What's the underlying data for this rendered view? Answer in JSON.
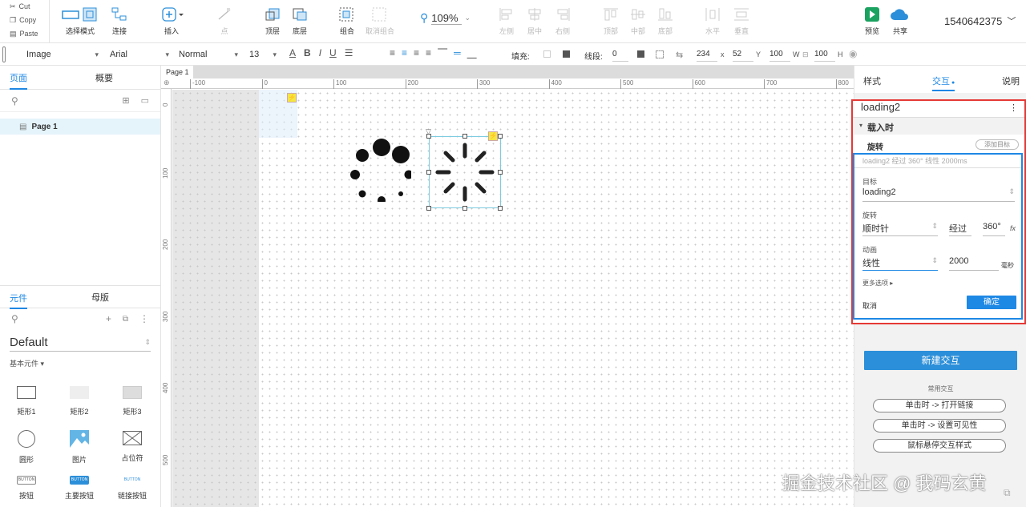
{
  "clipboard": {
    "cut": "Cut",
    "copy": "Copy",
    "paste": "Paste"
  },
  "toolbar": {
    "select_mode": "选择模式",
    "connect": "连接",
    "insert": "插入",
    "point": "点",
    "top": "顶层",
    "bottom": "底层",
    "group": "组合",
    "ungroup": "取消组合",
    "zoom": "109%",
    "left": "左侧",
    "center": "居中",
    "right": "右侧",
    "top_align": "顶部",
    "middle": "中部",
    "bottom_align": "底部",
    "horizontal": "水平",
    "vertical": "垂直",
    "preview": "预览",
    "share": "共享",
    "user": "1540642375"
  },
  "format": {
    "element_type": "Image",
    "font": "Arial",
    "style": "Normal",
    "size": "13",
    "fill_label": "填充:",
    "line_label": "线段:",
    "line_value": "0",
    "x": "234",
    "x_label": "x",
    "y": "52",
    "y_label": "Y",
    "w": "100",
    "w_label": "W",
    "h": "100",
    "h_label": "H"
  },
  "left_panel": {
    "tab_pages": "页面",
    "tab_outline": "概要",
    "page1": "Page 1",
    "tab_widgets": "元件",
    "tab_masters": "母版",
    "library": "Default",
    "section": "基本元件 ▾",
    "widgets": [
      {
        "label": "矩形1"
      },
      {
        "label": "矩形2"
      },
      {
        "label": "矩形3"
      },
      {
        "label": "圆形"
      },
      {
        "label": "图片"
      },
      {
        "label": "占位符"
      },
      {
        "label": "按钮",
        "preview": "BUTTON"
      },
      {
        "label": "主要按钮",
        "preview": "BUTTON"
      },
      {
        "label": "链接按钮",
        "preview": "BUTTON"
      }
    ]
  },
  "canvas": {
    "tab": "Page 1",
    "ruler_h": [
      "-100",
      "0",
      "100",
      "200",
      "300",
      "400",
      "500",
      "600",
      "700",
      "800"
    ],
    "ruler_v": [
      "0",
      "100",
      "200",
      "300",
      "400",
      "500"
    ]
  },
  "right_panel": {
    "tab_style": "样式",
    "tab_interaction": "交互",
    "tab_notes": "说明",
    "element_name": "loading2",
    "event": "载入时",
    "action": "旋转",
    "add_target": "添加目标",
    "summary": "loading2 经过 360° 线性 2000ms",
    "target_label": "目标",
    "target_value": "loading2",
    "rotate_label": "旋转",
    "direction": "顺时针",
    "through": "经过",
    "degrees": "360°",
    "anim_label": "动画",
    "easing": "线性",
    "duration": "2000",
    "ms": "毫秒",
    "more": "更多选项 ▸",
    "cancel": "取消",
    "ok": "确定",
    "new_interaction": "新建交互",
    "common": "常用交互",
    "common_items": [
      "单击时 -> 打开链接",
      "单击时 -> 设置可见性",
      "鼠标悬停交互样式"
    ]
  },
  "watermark": "掘金技术社区 @ 我码玄黄",
  "colors": {
    "accent": "#1e88e5",
    "highlight_border": "#e53935",
    "selection": "#7ecbe0"
  }
}
